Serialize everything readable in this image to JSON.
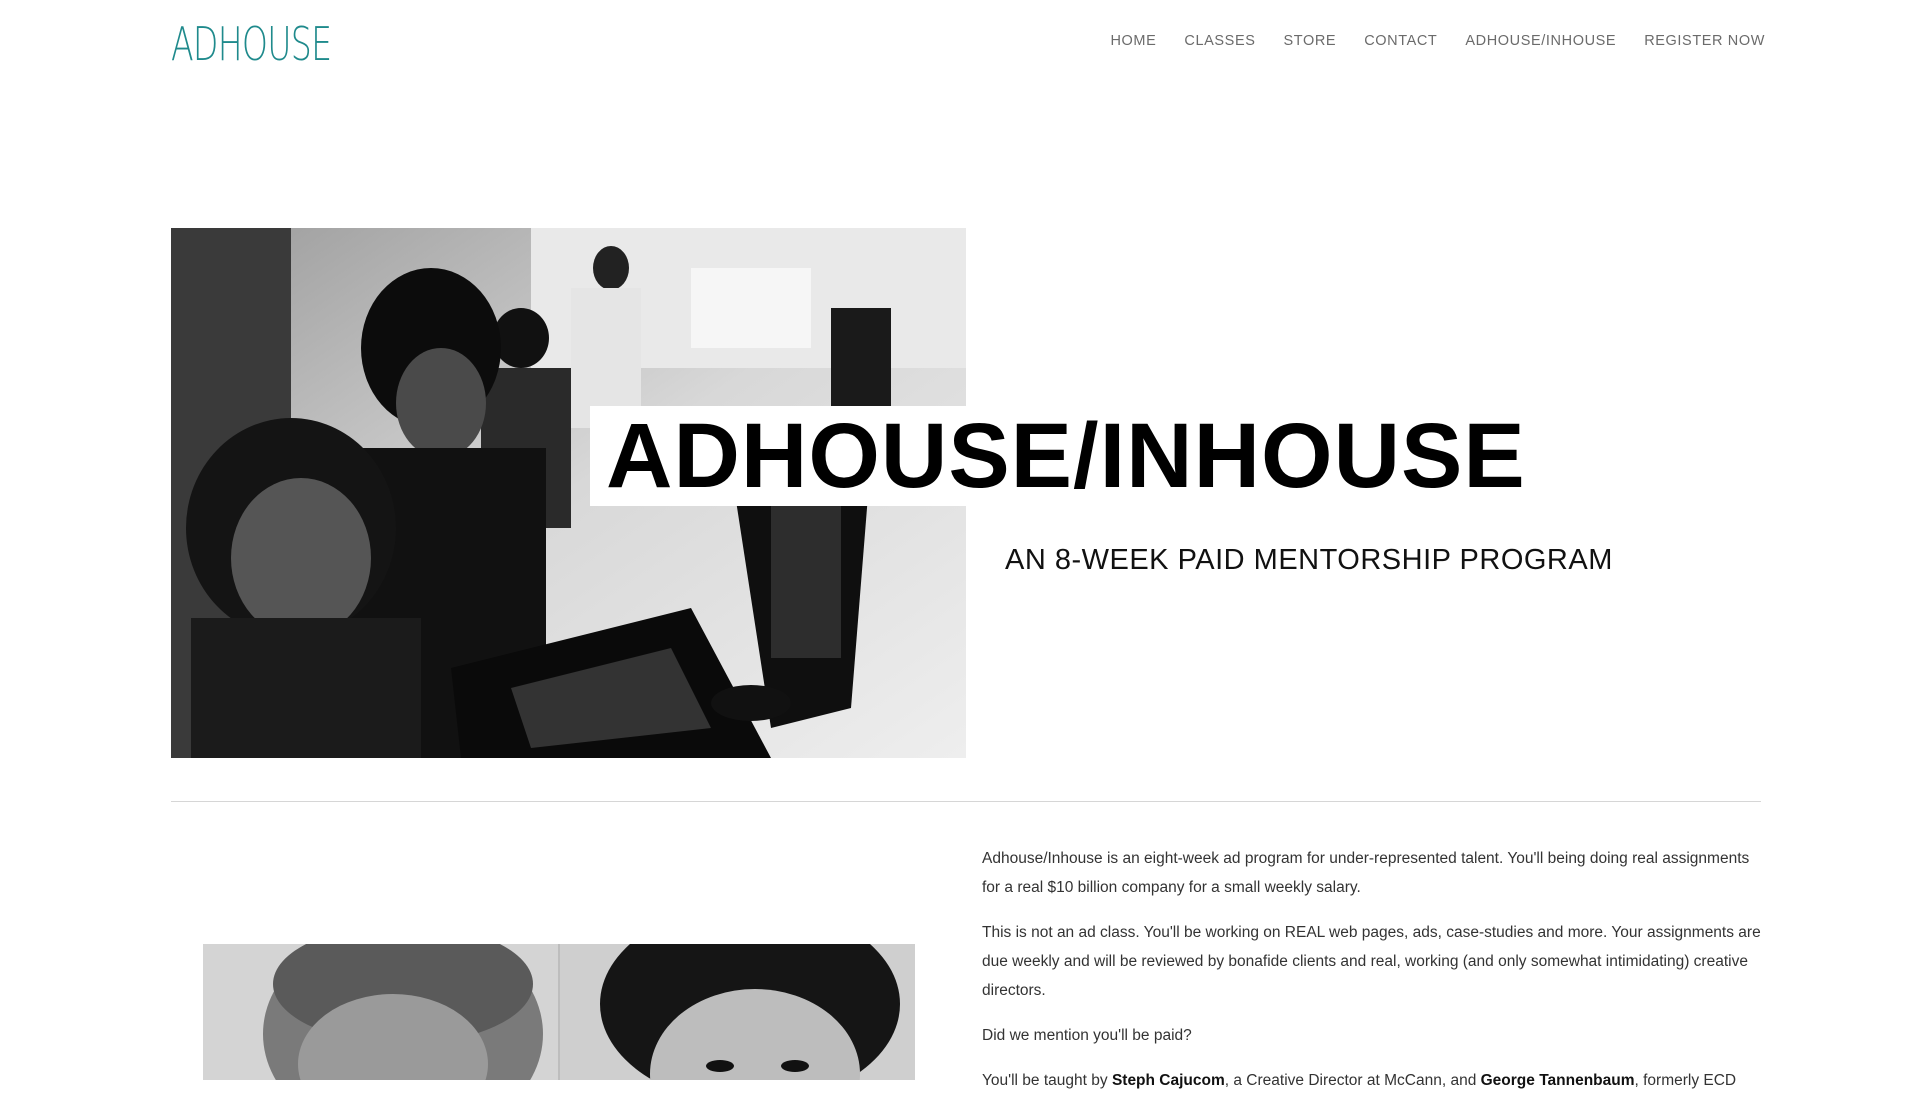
{
  "brand": {
    "logo_text": "ADHOUSE",
    "accent_color": "#1f8a8c"
  },
  "nav": {
    "items": [
      {
        "label": "HOME"
      },
      {
        "label": "CLASSES"
      },
      {
        "label": "STORE"
      },
      {
        "label": "CONTACT"
      },
      {
        "label": "ADHOUSE/INHOUSE"
      },
      {
        "label": "REGISTER NOW"
      }
    ]
  },
  "hero": {
    "title": "ADHOUSE/INHOUSE",
    "subtitle": "AN 8-WEEK PAID MENTORSHIP PROGRAM",
    "photo": "black-and-white photo of people working at laptops"
  },
  "body": {
    "p1": "Adhouse/Inhouse is an eight-week ad program for under-represented talent. You'll being doing real assignments for a real $10 billion company for a small weekly salary.",
    "p2": "This is not an ad class. You'll be working on REAL web pages, ads, case-studies and more. Your assignments are due weekly and will be reviewed by bonafide clients and real, working (and only somewhat intimidating) creative directors.",
    "p3": "Did we mention you'll be paid?",
    "p4_pre": "You'll be taught by ",
    "p4_name1": "Steph Cajucom",
    "p4_mid": ", a Creative Director at McCann, and ",
    "p4_name2": "George Tannenbaum",
    "p4_post": ", formerly ECD"
  }
}
